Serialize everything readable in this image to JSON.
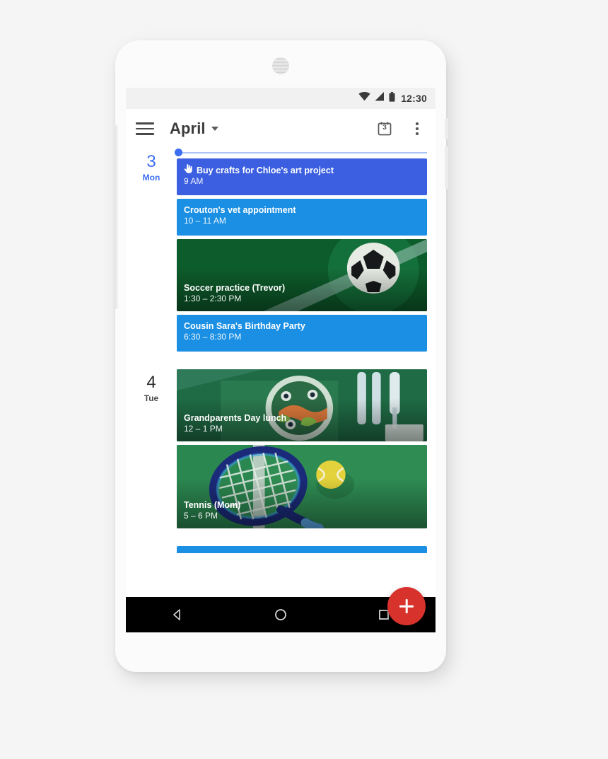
{
  "device": {
    "speaker_icon": "speaker-grille",
    "frame_color": "#fbfbfb"
  },
  "status_bar": {
    "time": "12:30",
    "icons": [
      "wifi-icon",
      "cellular-signal-icon",
      "battery-icon"
    ]
  },
  "app_bar": {
    "menu_icon": "hamburger-menu-icon",
    "title": "April",
    "dropdown_icon": "chevron-down-icon",
    "today_icon": "calendar-today-icon",
    "today_date_number": "3",
    "overflow_icon": "overflow-menu-icon"
  },
  "agenda": {
    "now_indicator_color": "#3b6ef0",
    "days": [
      {
        "date_number": "3",
        "day_of_week": "Mon",
        "is_today": true,
        "events": [
          {
            "title": "Buy crafts for Chloe's art project",
            "time": "9 AM",
            "style": "plain",
            "color": "#3b5fe0",
            "icon": "task-hand-icon"
          },
          {
            "title": "Crouton's vet appointment",
            "time": "10 – 11 AM",
            "style": "plain",
            "color": "#1a8fe3",
            "icon": ""
          },
          {
            "title": "Soccer practice (Trevor)",
            "time": "1:30 – 2:30 PM",
            "style": "image",
            "color": "#0d5c2b",
            "art": "soccer-ball-field-art",
            "icon": ""
          },
          {
            "title": "Cousin Sara's Birthday Party",
            "time": "6:30 – 8:30 PM",
            "style": "plain",
            "color": "#1a8fe3",
            "icon": ""
          }
        ]
      },
      {
        "date_number": "4",
        "day_of_week": "Tue",
        "is_today": false,
        "events": [
          {
            "title": "Grandparents Day lunch",
            "time": "12 – 1 PM",
            "style": "image",
            "color": "#2f7a59",
            "art": "food-plate-art",
            "icon": ""
          },
          {
            "title": "Tennis (Mom)",
            "time": "5 – 6 PM",
            "style": "image",
            "color": "#2a8f4e",
            "art": "tennis-racket-art",
            "icon": ""
          }
        ]
      }
    ],
    "partial_next_event_color": "#1a8fe3"
  },
  "fab": {
    "icon": "plus-icon",
    "color": "#d8322c"
  },
  "nav_bar": {
    "back_icon": "back-triangle-icon",
    "home_icon": "home-circle-icon",
    "recents_icon": "recents-square-icon"
  }
}
